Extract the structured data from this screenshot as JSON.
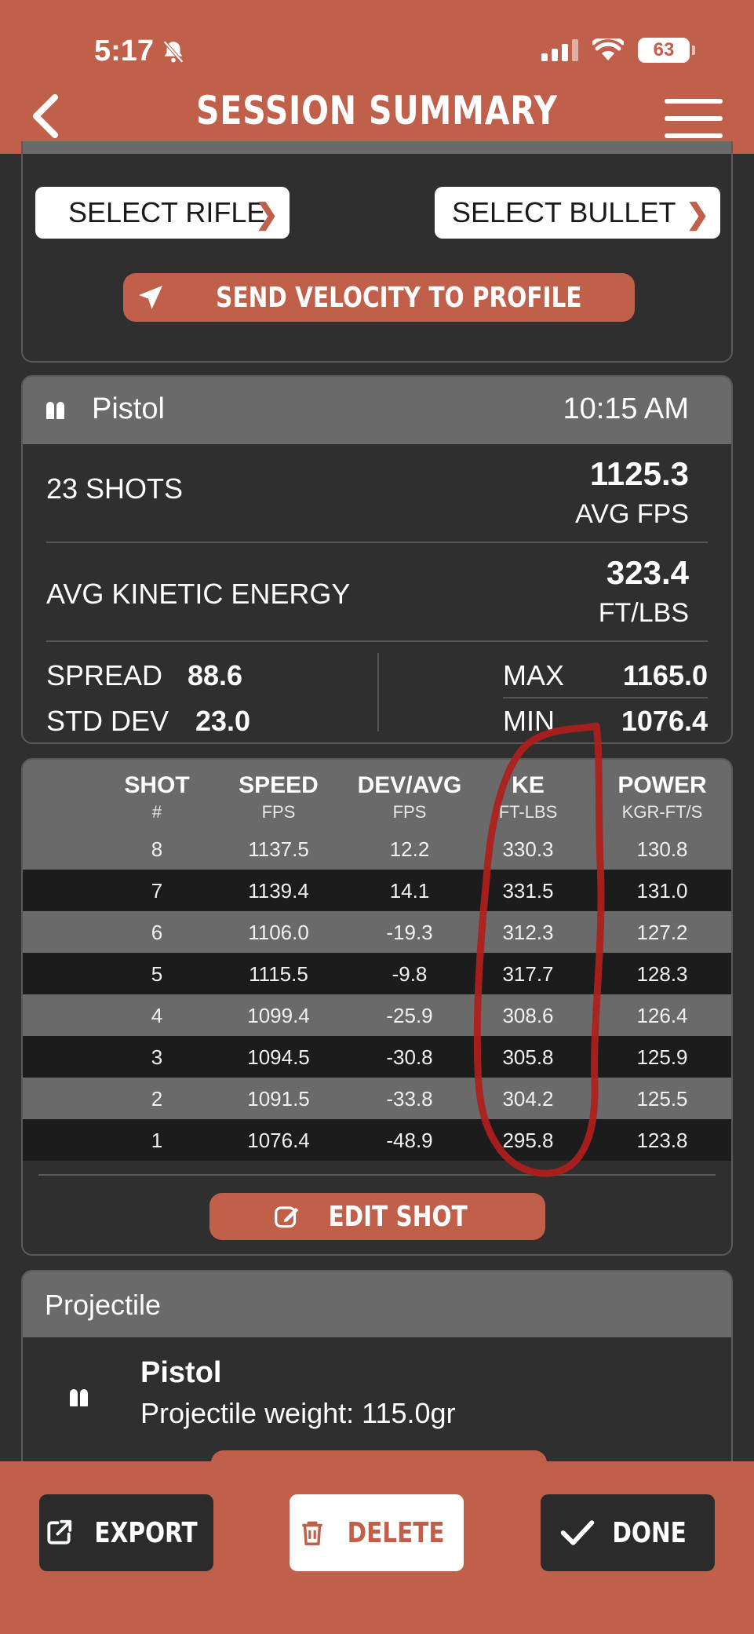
{
  "status_bar": {
    "time": "5:17",
    "battery": "63"
  },
  "header": {
    "title": "SESSION SUMMARY"
  },
  "top_card": {
    "select_rifle": "SELECT RIFLE",
    "select_bullet": "SELECT BULLET",
    "send_velocity": "SEND VELOCITY TO PROFILE"
  },
  "session": {
    "name": "Pistol",
    "time": "10:15 AM",
    "shots_label": "23 SHOTS",
    "avg_fps_value": "1125.3",
    "avg_fps_label": "AVG  FPS",
    "ke_label": "AVG KINETIC ENERGY",
    "ke_value": "323.4",
    "ke_unit": "FT/LBS",
    "spread_label": "SPREAD",
    "spread_value": "88.6",
    "stddev_label": "STD DEV",
    "stddev_value": "23.0",
    "max_label": "MAX",
    "max_value": "1165.0",
    "min_label": "MIN",
    "min_value": "1076.4"
  },
  "table": {
    "headers": [
      {
        "title": "SHOT",
        "unit": "#"
      },
      {
        "title": "SPEED",
        "unit": "FPS"
      },
      {
        "title": "DEV/AVG",
        "unit": "FPS"
      },
      {
        "title": "KE",
        "unit": "FT-LBS"
      },
      {
        "title": "POWER",
        "unit": "KGR-FT/S"
      }
    ],
    "rows": [
      [
        "8",
        "1137.5",
        "12.2",
        "330.3",
        "130.8"
      ],
      [
        "7",
        "1139.4",
        "14.1",
        "331.5",
        "131.0"
      ],
      [
        "6",
        "1106.0",
        "-19.3",
        "312.3",
        "127.2"
      ],
      [
        "5",
        "1115.5",
        "-9.8",
        "317.7",
        "128.3"
      ],
      [
        "4",
        "1099.4",
        "-25.9",
        "308.6",
        "126.4"
      ],
      [
        "3",
        "1094.5",
        "-30.8",
        "305.8",
        "125.9"
      ],
      [
        "2",
        "1091.5",
        "-33.8",
        "304.2",
        "125.5"
      ],
      [
        "1",
        "1076.4",
        "-48.9",
        "295.8",
        "123.8"
      ]
    ],
    "edit_shot": "EDIT SHOT"
  },
  "projectile": {
    "section_title": "Projectile",
    "name": "Pistol",
    "weight_text": "Projectile weight:  115.0gr"
  },
  "footer": {
    "export": "EXPORT",
    "delete": "DELETE",
    "done": "DONE"
  },
  "colors": {
    "accent": "#c0604a",
    "background": "#2f2f2f",
    "panel": "#6a6a6a",
    "row_dark": "#1c1c1c",
    "annotation": "#b0201c"
  }
}
